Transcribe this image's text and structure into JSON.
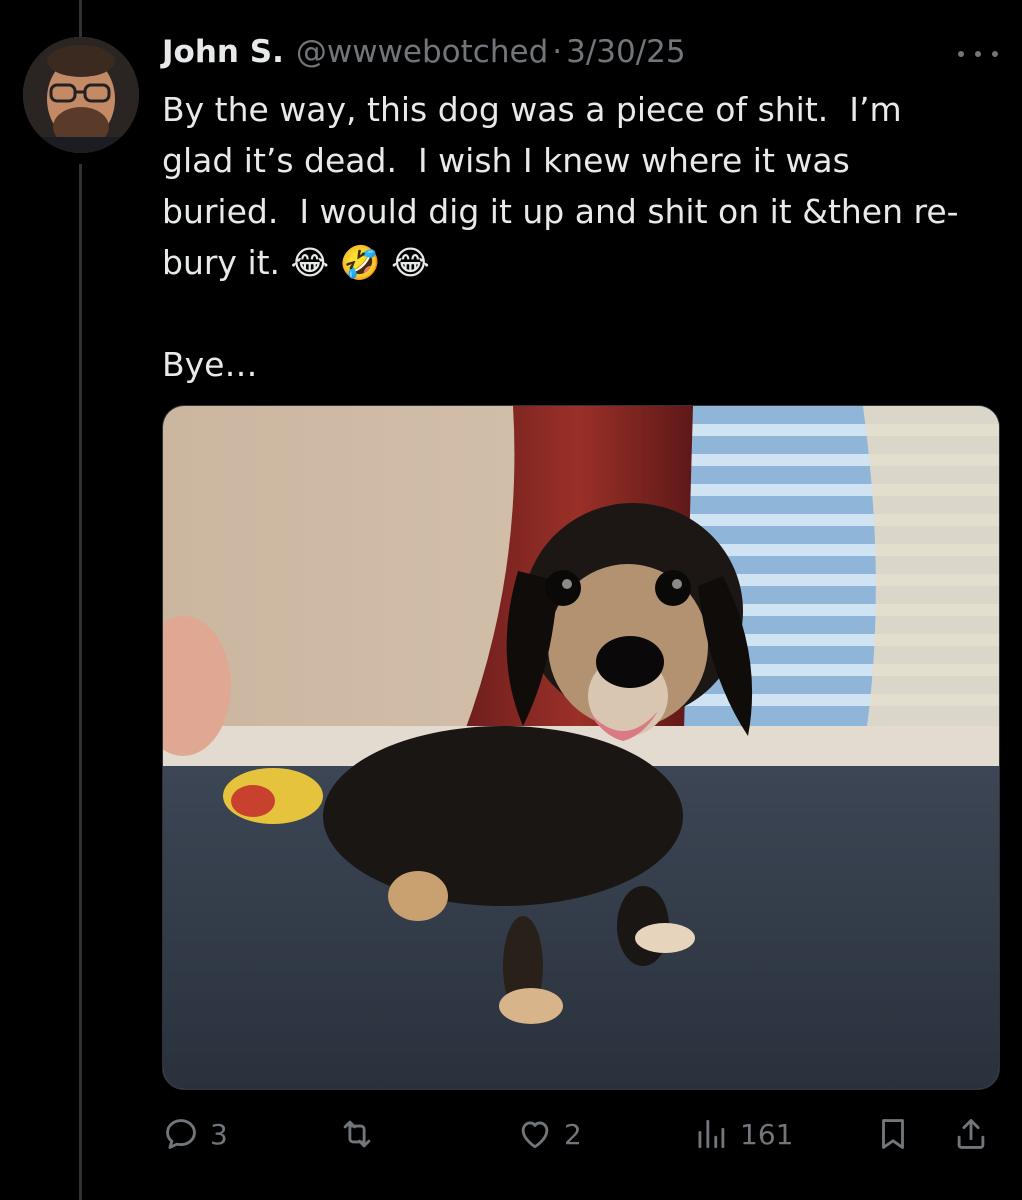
{
  "author": {
    "name": "John S.",
    "handle": "@wwwebotched",
    "separator": "·",
    "date": "3/30/25"
  },
  "tweet": {
    "text": "By the way, this dog was a piece of shit.  I’m glad it’s dead.  I wish I knew where it was buried.  I would dig it up and shit on it &then re-bury it. 😂 🤣 😂\n\nBye…"
  },
  "media": {
    "icon": "photo-of-dog"
  },
  "actions": {
    "reply_count": "3",
    "retweet_count": "",
    "like_count": "2",
    "views_count": "161"
  },
  "icons": {
    "more": "more-horizontal-icon",
    "reply": "reply-icon",
    "retweet": "retweet-icon",
    "like": "heart-icon",
    "views": "views-icon",
    "bookmark": "bookmark-icon",
    "share": "share-icon"
  },
  "colors": {
    "background": "#000000",
    "text": "#e7e9ea",
    "secondary": "#71767b"
  }
}
